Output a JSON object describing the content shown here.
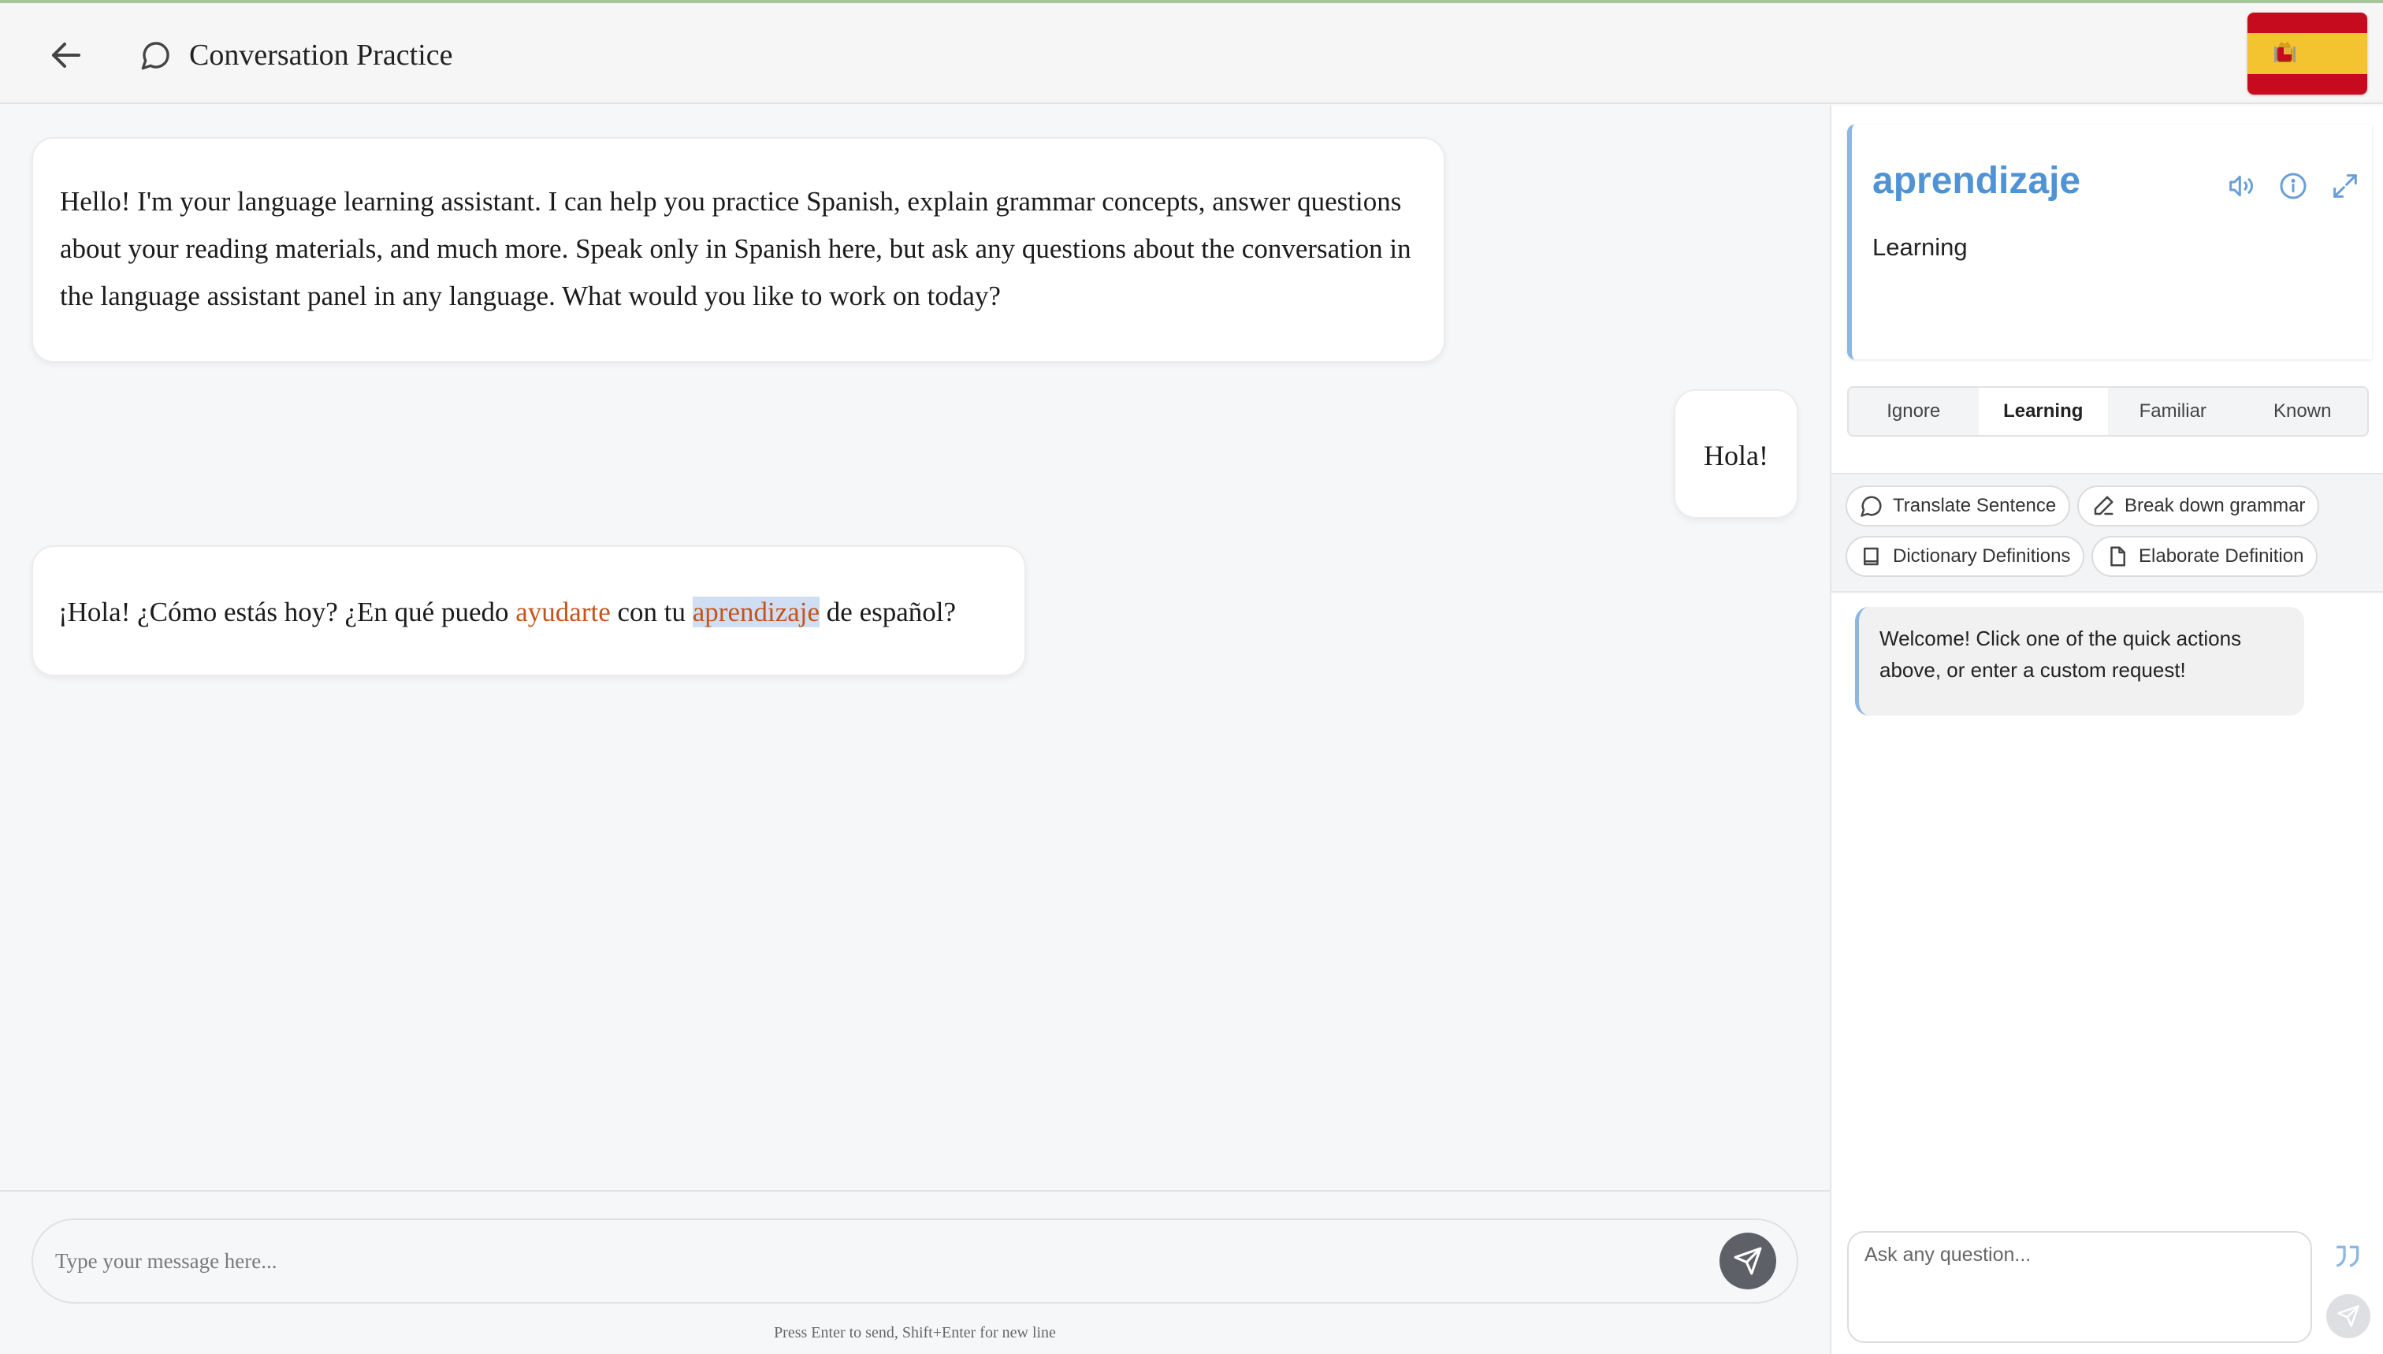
{
  "header": {
    "title": "Conversation Practice",
    "back_icon": "arrow-left-icon",
    "title_icon": "chat-bubble-icon",
    "language_flag": "spain-flag"
  },
  "messages": [
    {
      "role": "assistant",
      "text": "Hello! I'm your language learning assistant. I can help you practice Spanish, explain grammar concepts, answer questions about your reading materials, and much more. Speak only in Spanish here, but ask any questions about the conversation in the language assistant panel in any language. What would you like to work on today?"
    },
    {
      "role": "user",
      "text": "Hola!"
    },
    {
      "role": "assistant",
      "segments": [
        "¡Hola! ¿Cómo estás hoy? ¿En qué puedo ",
        "ayudarte",
        " con tu ",
        "aprendizaje",
        " de español?"
      ]
    }
  ],
  "composer": {
    "placeholder": "Type your message here...",
    "hint": "Press Enter to send, Shift+Enter for new line",
    "send_icon": "send-icon"
  },
  "word_panel": {
    "word": "aprendizaje",
    "translation": "Learning",
    "icons": [
      "speaker-icon",
      "info-icon",
      "expand-icon"
    ],
    "statuses": [
      "Ignore",
      "Learning",
      "Familiar",
      "Known"
    ],
    "active_status": "Learning"
  },
  "quick_actions": [
    {
      "label": "Translate Sentence",
      "icon": "chat-bubble-icon"
    },
    {
      "label": "Break down grammar",
      "icon": "pen-icon"
    },
    {
      "label": "Dictionary Definitions",
      "icon": "book-icon"
    },
    {
      "label": "Elaborate Definition",
      "icon": "document-icon"
    }
  ],
  "assistant_panel": {
    "welcome": "Welcome! Click one of the quick actions above, or enter a custom request!",
    "ask_placeholder": "Ask any question...",
    "quote_icon": "quote-icon",
    "send_icon": "send-icon"
  },
  "colors": {
    "highlight_word": "#c7531b",
    "word_title": "#4f93d4",
    "accent_border": "#8cb7e2",
    "selection": "#cfdef2"
  }
}
